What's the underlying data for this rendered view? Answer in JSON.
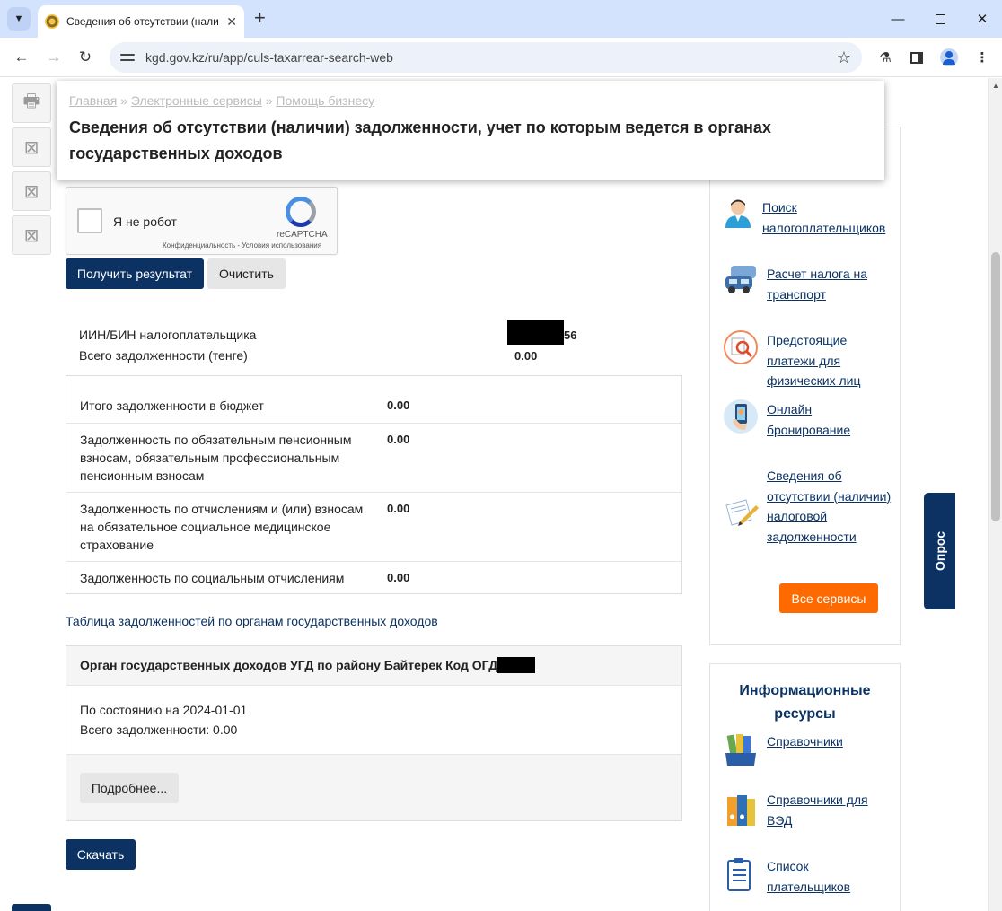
{
  "browser": {
    "tab_title": "Сведения об отсутствии (нали",
    "url": "kgd.gov.kz/ru/app/culs-taxarrear-search-web"
  },
  "breadcrumb": {
    "home": "Главная",
    "sep": "»",
    "eservices": "Электронные сервисы",
    "help": "Помощь бизнесу"
  },
  "page_title": "Сведения об отсутствии (наличии) задолженности, учет по которым ведется в органах государственных доходов",
  "captcha": {
    "label": "Я не робот",
    "brand": "reCAPTCHA",
    "links": "Конфиденциальность - Условия использования"
  },
  "form": {
    "get_result": "Получить результат",
    "clear": "Очистить"
  },
  "summary": {
    "iin_label": "ИИН/БИН налогоплательщика",
    "iin_suffix": "56",
    "total_label": "Всего задолженности (тенге)",
    "total_value": "0.00"
  },
  "debts": [
    {
      "name": "Итого задолженности в бюджет",
      "value": "0.00"
    },
    {
      "name": "Задолженность по обязательным пенсионным взносам, обязательным профессиональным пенсионным взносам",
      "value": "0.00"
    },
    {
      "name": "Задолженность по отчислениям и (или) взносам на обязательное социальное медицинское страхование",
      "value": "0.00"
    },
    {
      "name": "Задолженность по социальным отчислениям",
      "value": "0.00"
    }
  ],
  "table_link": "Таблица задолженностей по органам государственных доходов",
  "organ": {
    "title": "Орган государственных доходов УГД по району Байтерек Код ОГД",
    "as_of": "По состоянию на 2024-01-01",
    "total": "Всего задолженности: 0.00",
    "details": "Подробнее..."
  },
  "download": "Скачать",
  "services": {
    "items": [
      {
        "label": "Поиск налогоплательщиков",
        "icon": "person-icon"
      },
      {
        "label": "Расчет налога на транспорт",
        "icon": "cars-icon"
      },
      {
        "label": "Предстоящие платежи для физических лиц",
        "icon": "magnifier-doc-icon"
      },
      {
        "label": "Онлайн бронирование",
        "icon": "phone-hand-icon"
      },
      {
        "label": "Сведения об отсутствии (наличии) налоговой задолженности",
        "icon": "document-pen-icon"
      }
    ],
    "all_services": "Все сервисы"
  },
  "info": {
    "title": "Информационные ресурсы",
    "items": [
      {
        "label": "Справочники",
        "icon": "books-icon"
      },
      {
        "label": "Справочники для ВЭД",
        "icon": "binders-icon"
      },
      {
        "label": "Список плательщиков",
        "icon": "clipboard-icon"
      }
    ]
  },
  "survey": "Опрос",
  "colors": {
    "primary": "#0b3263",
    "accent": "#ff6a00"
  }
}
